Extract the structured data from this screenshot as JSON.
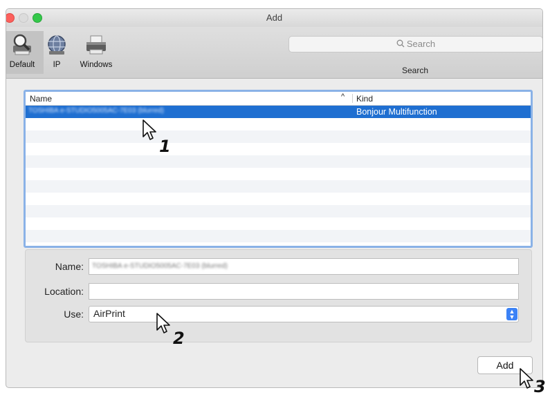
{
  "window": {
    "title": "Add"
  },
  "toolbar": {
    "buttons": [
      {
        "label": "Default",
        "icon": "magnifier-printer-icon",
        "active": true
      },
      {
        "label": "IP",
        "icon": "globe-icon",
        "active": false
      },
      {
        "label": "Windows",
        "icon": "printer-icon",
        "active": false
      }
    ],
    "search_placeholder": "Search",
    "search_caption": "Search"
  },
  "printer_list": {
    "columns": [
      "Name",
      "Kind"
    ],
    "rows": [
      {
        "name": "TOSHIBA e-STUDIO5005AC-7E03 (blurred)",
        "kind": "Bonjour Multifunction",
        "selected": true
      }
    ]
  },
  "form": {
    "name_label": "Name:",
    "name_value": "TOSHIBA e-STUDIO5005AC-7E03 (blurred)",
    "location_label": "Location:",
    "location_value": "",
    "use_label": "Use:",
    "use_value": "AirPrint"
  },
  "buttons": {
    "add_label": "Add"
  },
  "callouts": [
    "1",
    "2",
    "3"
  ],
  "colors": {
    "selection": "#1f6fd1",
    "focus_ring": "#8ab2e7",
    "popup_accent": "#3b82f6"
  }
}
